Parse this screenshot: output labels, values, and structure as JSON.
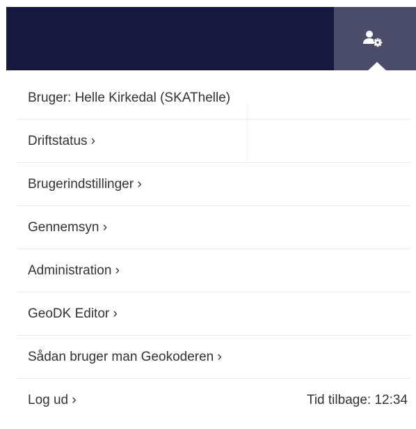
{
  "header": {
    "user_icon": "user-gear-icon"
  },
  "menu": {
    "user_label": "Bruger: Helle Kirkedal (SKAThelle)",
    "items": [
      {
        "label": "Driftstatus ›"
      },
      {
        "label": "Brugerindstillinger ›"
      },
      {
        "label": "Gennemsyn ›"
      },
      {
        "label": "Administration ›"
      },
      {
        "label": "GeoDK Editor ›"
      },
      {
        "label": "Sådan bruger man Geokoderen ›"
      }
    ],
    "logout_label": "Log ud ›",
    "time_left": "Tid tilbage: 12:34"
  },
  "colors": {
    "header_bg": "#171840",
    "user_button_bg": "#4a4c6a",
    "text": "#333333",
    "divider": "#e8e8e8"
  }
}
